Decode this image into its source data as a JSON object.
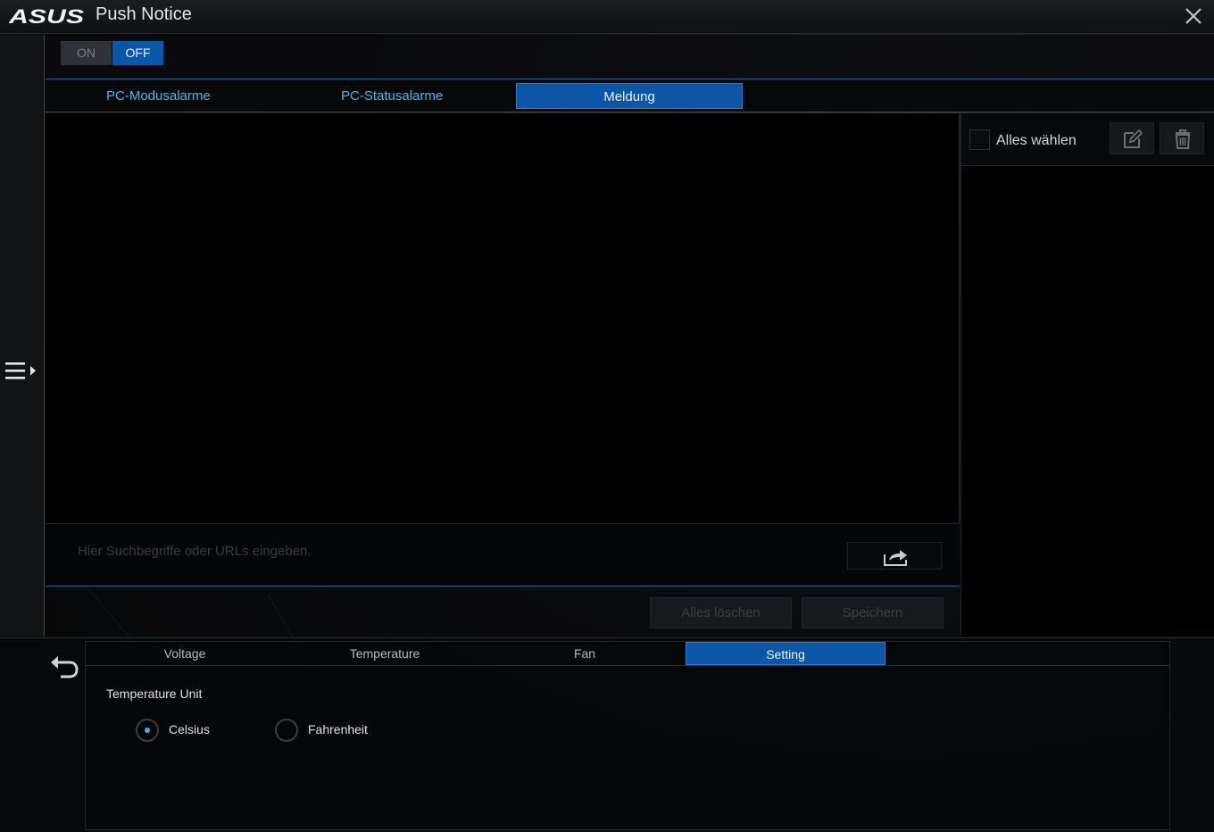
{
  "app": {
    "brand": "ASUS",
    "title": "Push Notice",
    "accent_color": "#0d55a6",
    "link_color": "#46b5ea"
  },
  "toggle": {
    "on_label": "ON",
    "off_label": "OFF",
    "selected": "OFF"
  },
  "tabs": {
    "pc_mode": "PC-Modusalarme",
    "pc_status": "PC-Statusalarme",
    "message": "Meldung",
    "active": "Meldung"
  },
  "message_panel": {
    "search_placeholder": "Hier Suchbegriffe oder URLs eingeben.",
    "search_value": "",
    "send_icon": "share-arrow-icon"
  },
  "actions": {
    "clear_all": "Alles löschen",
    "save": "Speichern"
  },
  "right_panel": {
    "select_all_label": "Alles wählen",
    "select_all_checked": false,
    "edit_icon": "edit-icon",
    "delete_icon": "trash-icon"
  },
  "bottom": {
    "tabs": [
      "Voltage",
      "Temperature",
      "Fan",
      "Setting"
    ],
    "active_tab": "Setting",
    "temperature_unit_label": "Temperature Unit",
    "units": [
      "Celsius",
      "Fahrenheit"
    ],
    "selected_unit": "Celsius"
  },
  "icons": {
    "close": "close-icon",
    "menu": "menu-expand-icon",
    "back": "back-arrow-icon"
  }
}
